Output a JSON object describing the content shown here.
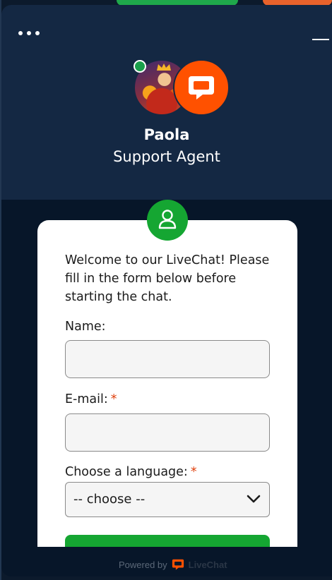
{
  "header": {
    "agent_name": "Paola",
    "agent_role": "Support Agent"
  },
  "form": {
    "welcome": "Welcome to our LiveChat! Please fill in the form below before starting the chat.",
    "name_label": "Name:",
    "name_value": "",
    "email_label": "E-mail:",
    "email_value": "",
    "required_mark": "*",
    "language_label": "Choose a language:",
    "language_selected": "-- choose --"
  },
  "footer": {
    "powered_by": "Powered by",
    "brand": "LiveChat"
  },
  "colors": {
    "header_bg": "#142843",
    "widget_bg": "#071629",
    "accent_green": "#15a632",
    "brand_orange": "#ff5100",
    "required_red": "#e0420f",
    "online": "#1a9f4b"
  },
  "icons": [
    "more-dots-icon",
    "minimize-icon",
    "livechat-logo-icon",
    "user-icon",
    "chevron-down-icon"
  ]
}
